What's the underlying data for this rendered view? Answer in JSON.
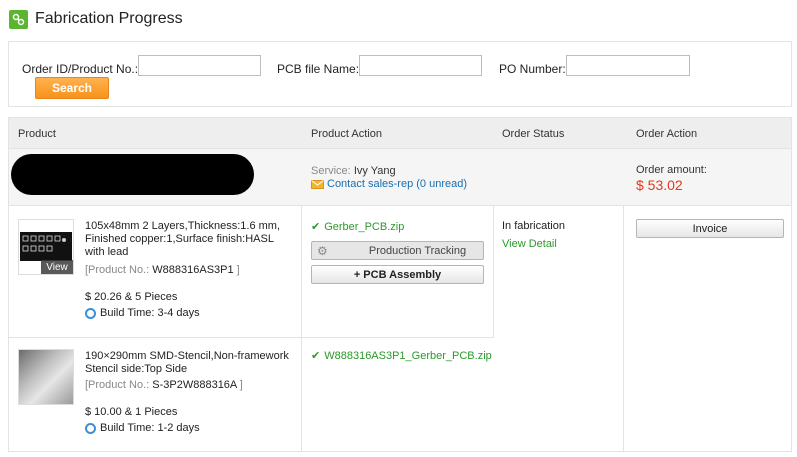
{
  "page": {
    "title": "Fabrication Progress"
  },
  "search": {
    "order_label": "Order ID/Product No.:",
    "pcb_label": "PCB file Name:",
    "po_label": "PO Number:",
    "order_value": "",
    "pcb_value": "",
    "po_value": "",
    "button": "Search"
  },
  "table": {
    "headers": [
      "Product",
      "Product Action",
      "Order Status",
      "Order Action"
    ],
    "order": {
      "service_label": "Service:",
      "service_name": "Ivy Yang",
      "contact_link": "Contact sales-rep (0 unread)",
      "amount_label": "Order amount:",
      "amount_value": "$ 53.02"
    },
    "items": [
      {
        "line1": "105x48mm 2 Layers,Thickness:1.6 mm,",
        "line2": "Finished copper:1,Surface finish:HASL",
        "line3": "with lead",
        "pn_open": "[Product No.:",
        "pn_value": "W888316AS3P1",
        "pn_close": "]",
        "price": "$ 20.26 & 5 Pieces",
        "build": "Build Time: 3-4 days",
        "thumb_badge": "View",
        "file": "Gerber_PCB.zip",
        "tracking": "Production Tracking",
        "assembly": "+ PCB Assembly",
        "status": "In fabrication",
        "detail": "View Detail",
        "invoice": "Invoice"
      },
      {
        "line1": "190×290mm SMD-Stencil,Non-framework",
        "line2": "Stencil side:Top Side",
        "pn_open": "[Product No.:",
        "pn_value": "S-3P2W888316A",
        "pn_close": "]",
        "price": "$ 10.00 & 1 Pieces",
        "build": "Build Time: 1-2 days",
        "file": "W888316AS3P1_Gerber_PCB.zip"
      }
    ]
  },
  "colors": {
    "accent": "#f7921b",
    "link": "#1a6fb0",
    "green": "#2a9a2a",
    "price": "#e23a1c"
  },
  "icons": [
    "logo-icon",
    "check-icon",
    "envelope-icon",
    "gear-icon",
    "clock-icon"
  ]
}
